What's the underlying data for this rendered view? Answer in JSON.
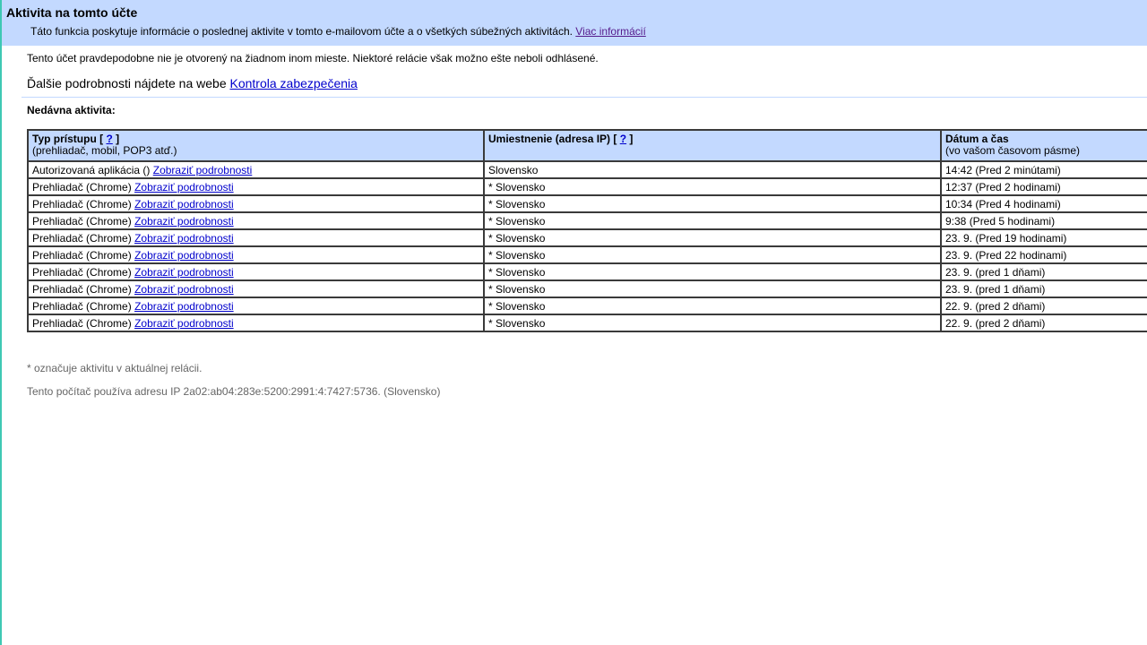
{
  "header": {
    "title": "Aktivita na tomto účte",
    "description": "Táto funkcia poskytuje informácie o poslednej aktivite v tomto e-mailovom účte a o všetkých súbežných aktivitách.",
    "more_info_link": "Viac informácií"
  },
  "notice": "Tento účet pravdepodobne nie je otvorený na žiadnom inom mieste. Niektoré relácie však možno ešte neboli odhlásené.",
  "more_details": {
    "text": "Ďalšie podrobnosti nájdete na webe",
    "link": "Kontrola zabezpečenia"
  },
  "recent_heading": "Nedávna aktivita:",
  "table": {
    "headers": {
      "type_title": "Typ prístupu [",
      "type_help": "?",
      "type_close": "]",
      "type_sub": "(prehliadač, mobil, POP3 atď.)",
      "location_title": "Umiestnenie (adresa IP) [",
      "location_help": "?",
      "location_close": "]",
      "datetime_title": "Dátum a čas",
      "datetime_sub": "(vo vašom časovom pásme)"
    },
    "rows": [
      {
        "type": "Autorizovaná aplikácia ()",
        "link": "Zobraziť podrobnosti",
        "location": "Slovensko",
        "time": "14:42 (Pred 2 minútami)"
      },
      {
        "type": "Prehliadač (Chrome)",
        "link": "Zobraziť podrobnosti",
        "location": "* Slovensko",
        "time": "12:37 (Pred 2 hodinami)"
      },
      {
        "type": "Prehliadač (Chrome)",
        "link": "Zobraziť podrobnosti",
        "location": "* Slovensko",
        "time": "10:34 (Pred 4 hodinami)"
      },
      {
        "type": "Prehliadač (Chrome)",
        "link": "Zobraziť podrobnosti",
        "location": "* Slovensko",
        "time": "9:38 (Pred 5 hodinami)"
      },
      {
        "type": "Prehliadač (Chrome)",
        "link": "Zobraziť podrobnosti",
        "location": "* Slovensko",
        "time": "23. 9. (Pred 19 hodinami)"
      },
      {
        "type": "Prehliadač (Chrome)",
        "link": "Zobraziť podrobnosti",
        "location": "* Slovensko",
        "time": "23. 9. (Pred 22 hodinami)"
      },
      {
        "type": "Prehliadač (Chrome)",
        "link": "Zobraziť podrobnosti",
        "location": "* Slovensko",
        "time": "23. 9. (pred 1 dňami)"
      },
      {
        "type": "Prehliadač (Chrome)",
        "link": "Zobraziť podrobnosti",
        "location": "* Slovensko",
        "time": "23. 9. (pred 1 dňami)"
      },
      {
        "type": "Prehliadač (Chrome)",
        "link": "Zobraziť podrobnosti",
        "location": "* Slovensko",
        "time": "22. 9. (pred 2 dňami)"
      },
      {
        "type": "Prehliadač (Chrome)",
        "link": "Zobraziť podrobnosti",
        "location": "* Slovensko",
        "time": "22. 9. (pred 2 dňami)"
      }
    ]
  },
  "footnote": "* označuje aktivitu v aktuálnej relácii.",
  "ip_note": "Tento počítač používa adresu IP 2a02:ab04:283e:5200:2991:4:7427:5736. (Slovensko)",
  "colors": {
    "header_bg": "#c3d9ff",
    "link": "#0000cc",
    "left_edge": "#3ec8b4"
  }
}
